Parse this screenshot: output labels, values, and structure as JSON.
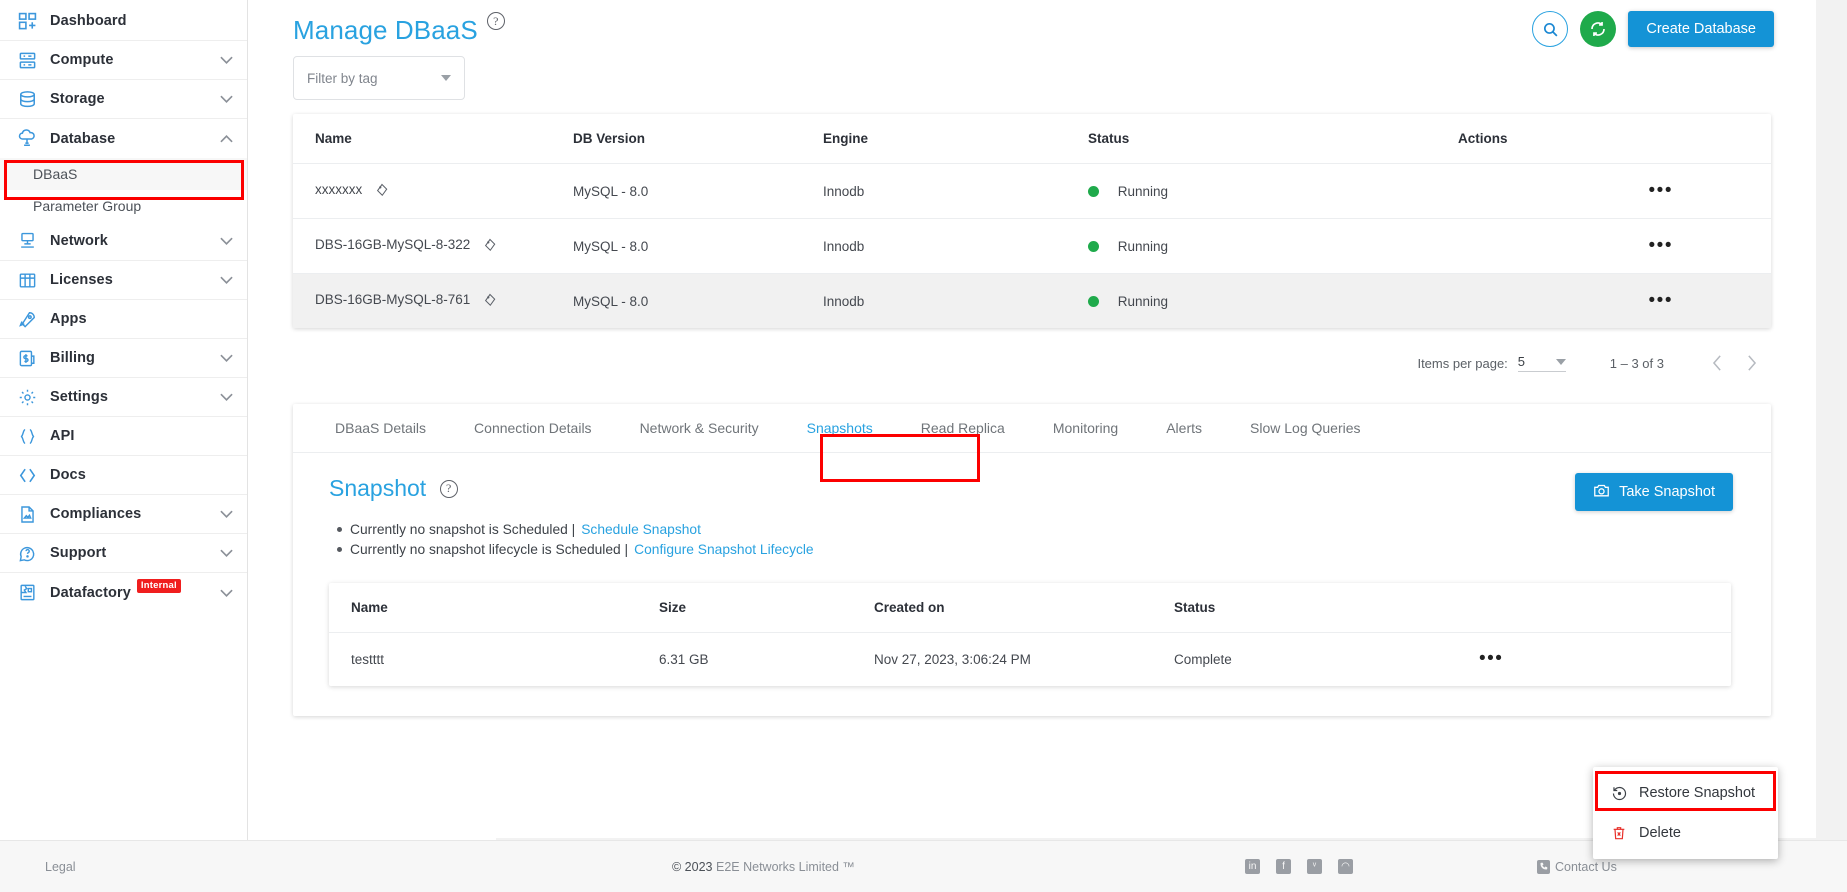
{
  "sidebar": {
    "items": [
      {
        "label": "Dashboard",
        "icon": "dashboard-icon",
        "expandable": false
      },
      {
        "label": "Compute",
        "icon": "server-icon",
        "expandable": true,
        "state": "collapsed"
      },
      {
        "label": "Storage",
        "icon": "database-stack-icon",
        "expandable": true,
        "state": "collapsed"
      },
      {
        "label": "Database",
        "icon": "cloud-database-icon",
        "expandable": true,
        "state": "expanded"
      },
      {
        "label": "Network",
        "icon": "network-icon",
        "expandable": true,
        "state": "collapsed"
      },
      {
        "label": "Licenses",
        "icon": "grid-icon",
        "expandable": true,
        "state": "collapsed"
      },
      {
        "label": "Apps",
        "icon": "rocket-icon",
        "expandable": false
      },
      {
        "label": "Billing",
        "icon": "dollar-icon",
        "expandable": true,
        "state": "collapsed"
      },
      {
        "label": "Settings",
        "icon": "gear-icon",
        "expandable": true,
        "state": "collapsed"
      },
      {
        "label": "API",
        "icon": "braces-icon",
        "expandable": false
      },
      {
        "label": "Docs",
        "icon": "code-icon",
        "expandable": false
      },
      {
        "label": "Compliances",
        "icon": "document-icon",
        "expandable": true,
        "state": "collapsed"
      },
      {
        "label": "Support",
        "icon": "support-icon",
        "expandable": true,
        "state": "collapsed"
      },
      {
        "label": "Datafactory",
        "icon": "factory-icon",
        "expandable": true,
        "state": "collapsed",
        "badge": "Internal"
      }
    ],
    "database_children": [
      {
        "label": "DBaaS",
        "active": true,
        "highlighted": true
      },
      {
        "label": "Parameter Group",
        "active": false
      }
    ]
  },
  "header": {
    "title": "Manage DBaaS",
    "help_icon": "question-mark-icon",
    "search_icon": "search-icon",
    "refresh_icon": "refresh-icon",
    "create_button": "Create Database"
  },
  "filter": {
    "placeholder": "Filter by tag",
    "value": "Filter by tag",
    "caret_icon": "chevron-down-icon"
  },
  "db_table": {
    "columns": [
      "Name",
      "DB Version",
      "Engine",
      "Status",
      "Actions"
    ],
    "rows": [
      {
        "name": "xxxxxxx",
        "db_version": "MySQL - 8.0",
        "engine": "Innodb",
        "status": "Running",
        "status_color": "#1faa4b",
        "actions": "•••",
        "selected": false
      },
      {
        "name": "DBS-16GB-MySQL-8-322",
        "db_version": "MySQL - 8.0",
        "engine": "Innodb",
        "status": "Running",
        "status_color": "#1faa4b",
        "actions": "•••",
        "selected": false
      },
      {
        "name": "DBS-16GB-MySQL-8-761",
        "db_version": "MySQL - 8.0",
        "engine": "Innodb",
        "status": "Running",
        "status_color": "#1faa4b",
        "actions": "•••",
        "selected": true
      }
    ]
  },
  "paginator": {
    "items_per_page_label": "Items per page:",
    "items_per_page_value": "5",
    "range": "1 – 3 of 3",
    "prev_icon": "chevron-left-icon",
    "next_icon": "chevron-right-icon"
  },
  "tabs": [
    {
      "label": "DBaaS Details",
      "active": false
    },
    {
      "label": "Connection Details",
      "active": false
    },
    {
      "label": "Network & Security",
      "active": false
    },
    {
      "label": "Snapshots",
      "active": true,
      "highlighted": true
    },
    {
      "label": "Read Replica",
      "active": false
    },
    {
      "label": "Monitoring",
      "active": false
    },
    {
      "label": "Alerts",
      "active": false
    },
    {
      "label": "Slow Log Queries",
      "active": false
    }
  ],
  "snapshot_panel": {
    "title": "Snapshot",
    "help_icon": "question-mark-icon",
    "take_snapshot_button": "Take Snapshot",
    "camera_icon": "camera-icon",
    "notes": [
      {
        "text": "Currently no snapshot is Scheduled |",
        "link": "Schedule Snapshot"
      },
      {
        "text": "Currently no snapshot lifecycle is Scheduled |",
        "link": "Configure Snapshot Lifecycle"
      }
    ],
    "table": {
      "columns": [
        "Name",
        "Size",
        "Created on",
        "Status",
        ""
      ],
      "rows": [
        {
          "name": "testttt",
          "size": "6.31 GB",
          "created_on": "Nov 27, 2023, 3:06:24 PM",
          "status": "Complete",
          "actions": "•••"
        }
      ]
    }
  },
  "context_menu": {
    "items": [
      {
        "label": "Restore Snapshot",
        "icon": "restore-icon",
        "highlighted": true
      },
      {
        "label": "Delete",
        "icon": "trash-icon",
        "highlighted": false
      }
    ]
  },
  "footer": {
    "legal": "Legal",
    "copyright_symbol": "© 2023",
    "copyright_text": "E2E Networks Limited ™",
    "social": [
      {
        "name": "linkedin-icon",
        "glyph": "in"
      },
      {
        "name": "facebook-icon",
        "glyph": "f"
      },
      {
        "name": "twitter-icon",
        "glyph": "ᵛ"
      },
      {
        "name": "rss-icon",
        "glyph": "◠"
      }
    ],
    "contact": "Contact Us",
    "contact_icon": "phone-icon"
  },
  "colors": {
    "accent": "#29a2e0",
    "primary_button": "#1493d6",
    "success": "#1faa4b",
    "highlight_box": "#fc0000",
    "badge_red": "#f01e1e"
  }
}
